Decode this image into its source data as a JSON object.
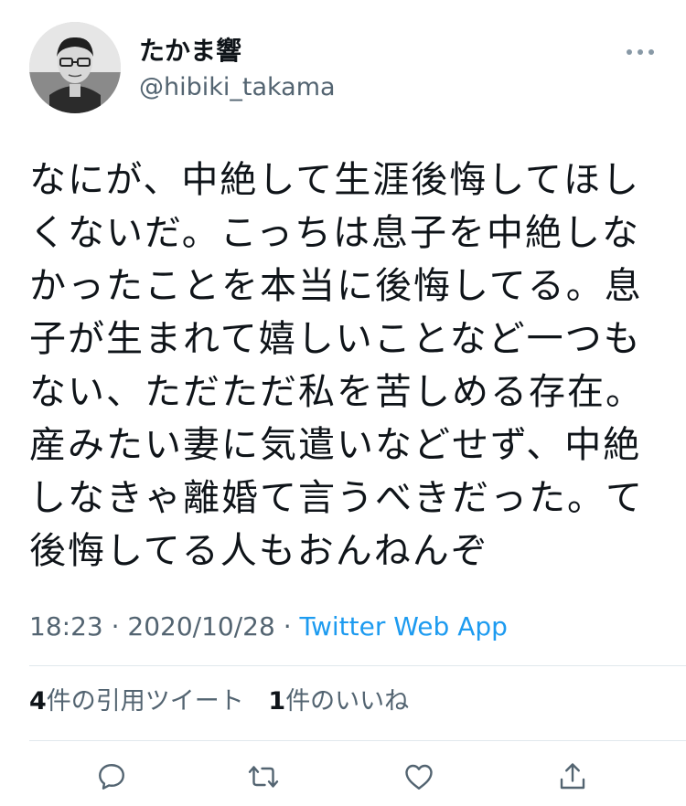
{
  "tweet": {
    "author": {
      "display_name": "たかま響",
      "handle": "@hibiki_takama"
    },
    "text_lines": [
      "なにが、中絶して生涯後悔してほし",
      "くないだ。こっちは息子を中絶しな",
      "かったことを本当に後悔してる。息",
      "子が生まれて嬉しいことなど一つも",
      "ない、ただただ私を苦しめる存在。",
      "産みたい妻に気遣いなどせず、中絶",
      "しなきゃ離婚て言うべきだった。て",
      "後悔してる人もおんねんぞ"
    ],
    "meta": {
      "time": "18:23",
      "separator": " · ",
      "date": "2020/10/28",
      "source": "Twitter Web App"
    },
    "stats": {
      "quotes_count": "4",
      "quotes_label": "件の引用ツイート",
      "likes_count": "1",
      "likes_label": "件のいいね"
    },
    "icons": {
      "more": "more-horizontal-icon",
      "reply": "reply-icon",
      "retweet": "retweet-icon",
      "like": "heart-icon",
      "share": "share-icon"
    },
    "colors": {
      "link": "#1d9bf0",
      "secondary_text": "#536471",
      "divider": "#e1e8ed",
      "icon": "#536471"
    }
  }
}
